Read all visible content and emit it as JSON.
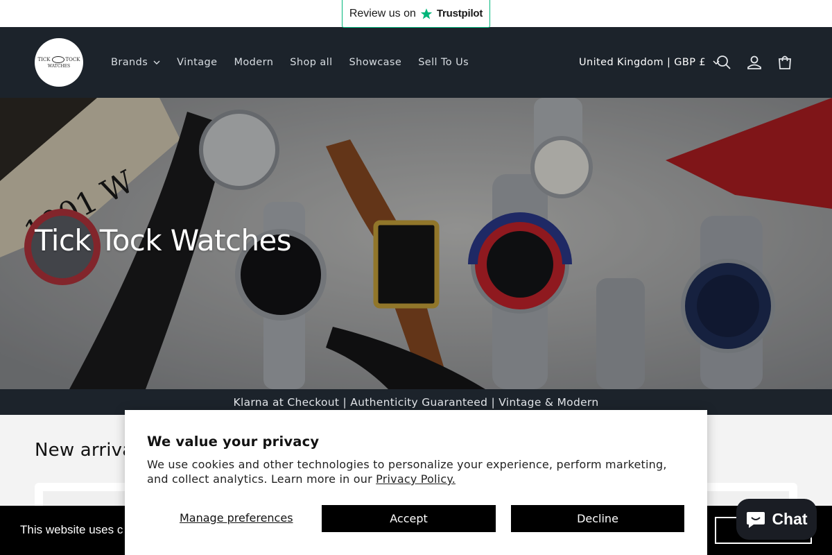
{
  "trustpilot": {
    "review_text": "Review us on",
    "brand": "Trustpilot",
    "color": "#00b67a"
  },
  "header": {
    "logo_top": "TICK TOCK",
    "logo_bottom": "WATCHES",
    "nav": [
      {
        "label": "Brands",
        "has_dropdown": true
      },
      {
        "label": "Vintage"
      },
      {
        "label": "Modern"
      },
      {
        "label": "Shop all"
      },
      {
        "label": "Showcase"
      },
      {
        "label": "Sell To Us"
      }
    ],
    "country_selector": "United Kingdom | GBP £",
    "icons": [
      "search-icon",
      "account-icon",
      "cart-icon"
    ],
    "background": "#1c232b"
  },
  "hero": {
    "title": "Tick Tock Watches"
  },
  "announcement": {
    "text": "Klarna at Checkout | Authenticity Guaranteed | Vintage & Modern"
  },
  "main": {
    "section_title": "New arrival"
  },
  "cookie_bar": {
    "text": "This website uses c"
  },
  "privacy": {
    "title": "We value your privacy",
    "body": "We use cookies and other technologies to personalize your experience, perform marketing, and collect analytics. Learn more in our ",
    "link": "Privacy Policy.",
    "manage_label": "Manage preferences",
    "accept_label": "Accept",
    "decline_label": "Decline"
  },
  "chat": {
    "label": "Chat"
  }
}
